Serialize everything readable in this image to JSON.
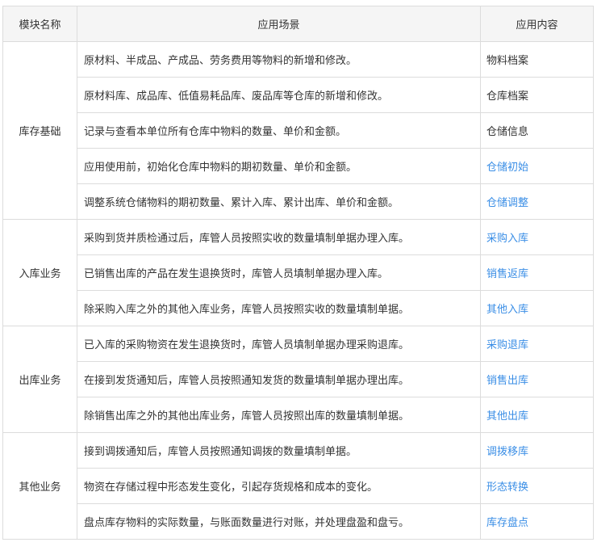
{
  "headers": [
    "模块名称",
    "应用场景",
    "应用内容"
  ],
  "link_color": "#3a8ee6",
  "groups": [
    {
      "module": "库存基础",
      "rows": [
        {
          "scene": "原材料、半成品、产成品、劳务费用等物料的新增和修改。",
          "content": "物料档案",
          "link": false
        },
        {
          "scene": "原材料库、成品库、低值易耗品库、废品库等仓库的新增和修改。",
          "content": "仓库档案",
          "link": false
        },
        {
          "scene": "记录与查看本单位所有仓库中物料的数量、单价和金额。",
          "content": "仓储信息",
          "link": false
        },
        {
          "scene": "应用使用前，初始化仓库中物料的期初数量、单价和金额。",
          "content": "仓储初始",
          "link": true
        },
        {
          "scene": "调整系统仓储物料的期初数量、累计入库、累计出库、单价和金额。",
          "content": "仓储调整",
          "link": true
        }
      ]
    },
    {
      "module": "入库业务",
      "rows": [
        {
          "scene": "采购到货并质检通过后，库管人员按照实收的数量填制单据办理入库。",
          "content": "采购入库",
          "link": true
        },
        {
          "scene": "已销售出库的产品在发生退换货时，库管人员填制单据办理入库。",
          "content": "销售返库",
          "link": true
        },
        {
          "scene": "除采购入库之外的其他入库业务，库管人员按照实收的数量填制单据。",
          "content": "其他入库",
          "link": true
        }
      ]
    },
    {
      "module": "出库业务",
      "rows": [
        {
          "scene": "已入库的采购物资在发生退换货时，库管人员填制单据办理采购退库。",
          "content": "采购退库",
          "link": true
        },
        {
          "scene": "在接到发货通知后，库管人员按照通知发货的数量填制单据办理出库。",
          "content": "销售出库",
          "link": true
        },
        {
          "scene": "除销售出库之外的其他出库业务，库管人员按照出库的数量填制单据。",
          "content": "其他出库",
          "link": true
        }
      ]
    },
    {
      "module": "其他业务",
      "rows": [
        {
          "scene": "接到调拨通知后，库管人员按照通知调拨的数量填制单据。",
          "content": "调拨移库",
          "link": true
        },
        {
          "scene": "物资在存储过程中形态发生变化，引起存货规格和成本的变化。",
          "content": "形态转换",
          "link": true
        },
        {
          "scene": "盘点库存物料的实际数量，与账面数量进行对账，并处理盘盈和盘亏。",
          "content": "库存盘点",
          "link": true
        }
      ]
    }
  ]
}
